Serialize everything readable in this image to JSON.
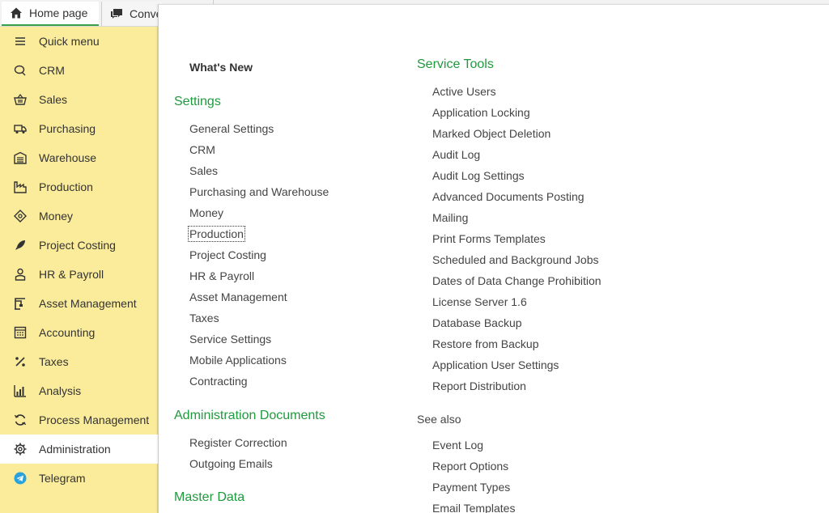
{
  "tabs": {
    "home_label": "Home page",
    "conv_label": "Conversations"
  },
  "sidebar": {
    "items": [
      {
        "label": "Quick menu",
        "icon": "menu-icon"
      },
      {
        "label": "CRM",
        "icon": "chat-icon"
      },
      {
        "label": "Sales",
        "icon": "basket-icon"
      },
      {
        "label": "Purchasing",
        "icon": "truck-icon"
      },
      {
        "label": "Warehouse",
        "icon": "warehouse-icon"
      },
      {
        "label": "Production",
        "icon": "factory-icon"
      },
      {
        "label": "Money",
        "icon": "money-icon"
      },
      {
        "label": "Project Costing",
        "icon": "rocket-icon"
      },
      {
        "label": "HR & Payroll",
        "icon": "person-icon"
      },
      {
        "label": "Asset Management",
        "icon": "crane-icon"
      },
      {
        "label": "Accounting",
        "icon": "ledger-icon"
      },
      {
        "label": "Taxes",
        "icon": "percent-icon"
      },
      {
        "label": "Analysis",
        "icon": "bar-chart-icon"
      },
      {
        "label": "Process Management",
        "icon": "cycle-icon"
      },
      {
        "label": "Administration",
        "icon": "gear-icon"
      },
      {
        "label": "Telegram",
        "icon": "telegram-icon"
      }
    ],
    "active": "Administration",
    "background": "#fbec9b"
  },
  "main": {
    "whats_new": "What's New",
    "settings": {
      "title": "Settings",
      "items": [
        "General Settings",
        "CRM",
        "Sales",
        "Purchasing and Warehouse",
        "Money",
        "Production",
        "Project Costing",
        "HR & Payroll",
        "Asset Management",
        "Taxes",
        "Service Settings",
        "Mobile Applications",
        "Contracting"
      ]
    },
    "admin_docs": {
      "title": "Administration Documents",
      "items": [
        "Register Correction",
        "Outgoing Emails"
      ]
    },
    "master_data": {
      "title": "Master Data"
    },
    "service_tools": {
      "title": "Service Tools",
      "items": [
        "Active Users",
        "Application Locking",
        "Marked Object Deletion",
        "Audit Log",
        "Audit Log Settings",
        "Advanced Documents Posting",
        "Mailing",
        "Print Forms Templates",
        "Scheduled and Background Jobs",
        "Dates of Data Change Prohibition",
        "License Server 1.6",
        "Database Backup",
        "Restore from Backup",
        "Application User Settings",
        "Report Distribution"
      ]
    },
    "see_also": {
      "title": "See also",
      "items": [
        "Event Log",
        "Report Options",
        "Payment Types",
        "Email Templates"
      ]
    },
    "accent_color": "#1f9a3d"
  }
}
